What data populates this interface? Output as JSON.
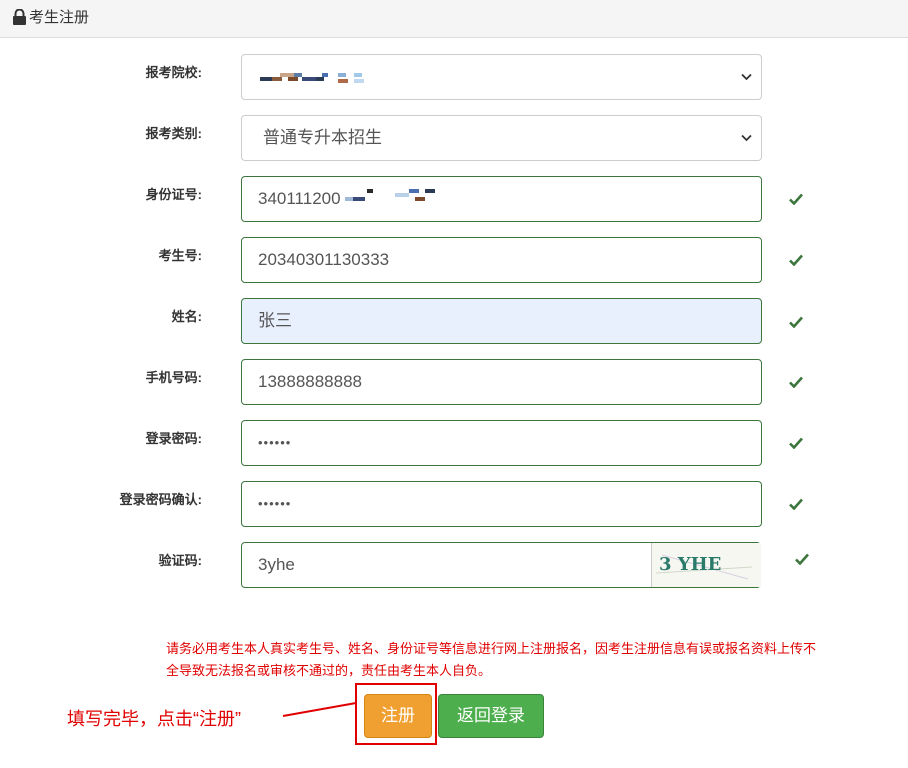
{
  "header": {
    "title": "考生注册",
    "icon": "lock-icon"
  },
  "form": {
    "school": {
      "label": "报考院校:",
      "value": ""
    },
    "category": {
      "label": "报考类别:",
      "value": "普通专升本招生"
    },
    "id_number": {
      "label": "身份证号:",
      "value": "340111200"
    },
    "exam_number": {
      "label": "考生号:",
      "value": "20340301130333"
    },
    "name": {
      "label": "姓名:",
      "value": "张三"
    },
    "phone": {
      "label": "手机号码:",
      "value": "13888888888"
    },
    "password": {
      "label": "登录密码:",
      "value": "••••••"
    },
    "password_confirm": {
      "label": "登录密码确认:",
      "value": "••••••"
    },
    "captcha": {
      "label": "验证码:",
      "value": "3yhe",
      "image_text": "3 YHE"
    }
  },
  "notice": "请务必用考生本人真实考生号、姓名、身份证号等信息进行网上注册报名，因考生注册信息有误或报名资料上传不全导致无法报名或审核不通过的，责任由考生本人自负。",
  "buttons": {
    "register": "注册",
    "back_to_login": "返回登录"
  },
  "annotation": "填写完毕，点击“注册”",
  "colors": {
    "valid": "#3c763d",
    "register": "#f0a030",
    "back": "#4cae4c",
    "annotation": "#e00000"
  }
}
